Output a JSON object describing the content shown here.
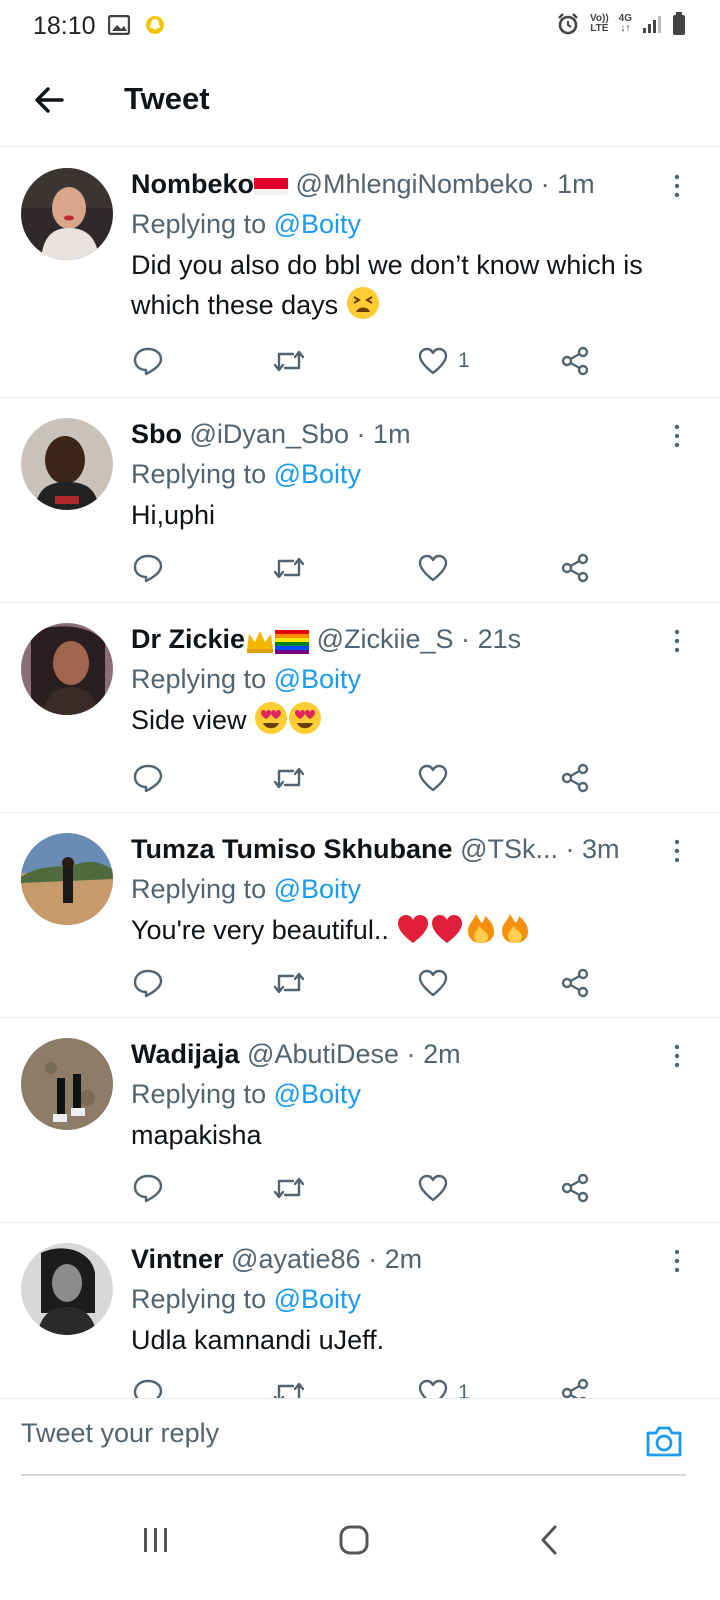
{
  "status_bar": {
    "time": "18:10",
    "network_label_top": "Vo))",
    "network_label_bottom": "LTE",
    "data_label": "4G"
  },
  "header": {
    "title": "Tweet"
  },
  "tweets": [
    {
      "name": "Nombeko",
      "handle": "@MhlengiNombeko",
      "time": "1m",
      "reply_prefix": "Replying to",
      "reply_handle": "@Boity",
      "text": "Did you also do bbl we don’t know which is which these days",
      "likes": "1"
    },
    {
      "name": "Sbo",
      "handle": "@iDyan_Sbo",
      "time": "1m",
      "reply_prefix": "Replying to",
      "reply_handle": "@Boity",
      "text": "Hi,uphi",
      "likes": ""
    },
    {
      "name": "Dr Zickie",
      "handle": "@Zickiie_S",
      "time": "21s",
      "reply_prefix": "Replying to",
      "reply_handle": "@Boity",
      "text": "Side view",
      "likes": ""
    },
    {
      "name": "Tumza Tumiso Skhubane",
      "handle": "@TSk...",
      "time": "3m",
      "reply_prefix": "Replying to",
      "reply_handle": "@Boity",
      "text": "You're very beautiful..",
      "likes": ""
    },
    {
      "name": "Wadijaja",
      "handle": "@AbutiDese",
      "time": "2m",
      "reply_prefix": "Replying to",
      "reply_handle": "@Boity",
      "text": "mapakisha",
      "likes": ""
    },
    {
      "name": "Vintner",
      "handle": "@ayatie86",
      "time": "2m",
      "reply_prefix": "Replying to",
      "reply_handle": "@Boity",
      "text": "Udla kamnandi uJeff.",
      "likes": "1"
    }
  ],
  "separator": "·",
  "composer": {
    "placeholder": "Tweet your reply"
  },
  "colors": {
    "link": "#1d9bf0",
    "secondary_text": "#536471",
    "primary_text": "#0f1419",
    "divider": "#e6ecf0"
  },
  "icons": {
    "header": [
      "back-arrow-icon"
    ],
    "tweet_actions": [
      "reply-icon",
      "retweet-icon",
      "like-icon",
      "share-icon"
    ],
    "composer": [
      "camera-icon"
    ],
    "nav": [
      "recent-apps-icon",
      "home-icon",
      "back-icon"
    ]
  }
}
